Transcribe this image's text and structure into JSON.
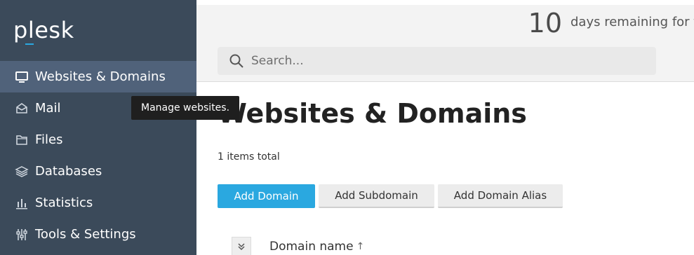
{
  "brand": {
    "logo_text": "plesk",
    "accent": "#2aa8e0"
  },
  "sidebar": {
    "items": [
      {
        "label": "Websites & Domains",
        "icon": "monitor-icon",
        "active": true
      },
      {
        "label": "Mail",
        "icon": "mail-icon"
      },
      {
        "label": "Files",
        "icon": "folder-icon"
      },
      {
        "label": "Databases",
        "icon": "database-icon"
      },
      {
        "label": "Statistics",
        "icon": "bar-chart-icon"
      },
      {
        "label": "Tools & Settings",
        "icon": "tools-icon"
      }
    ]
  },
  "tooltip": {
    "text": "Manage websites."
  },
  "trial": {
    "count": "10",
    "text": "days remaining for trial"
  },
  "search": {
    "placeholder": "Search..."
  },
  "main": {
    "title": "Websites & Domains",
    "items_total": "1 items total",
    "buttons": {
      "add_domain": "Add Domain",
      "add_subdomain": "Add Subdomain",
      "add_alias": "Add Domain Alias"
    },
    "table": {
      "column_domain": "Domain name",
      "sort_indicator": "↑"
    }
  }
}
